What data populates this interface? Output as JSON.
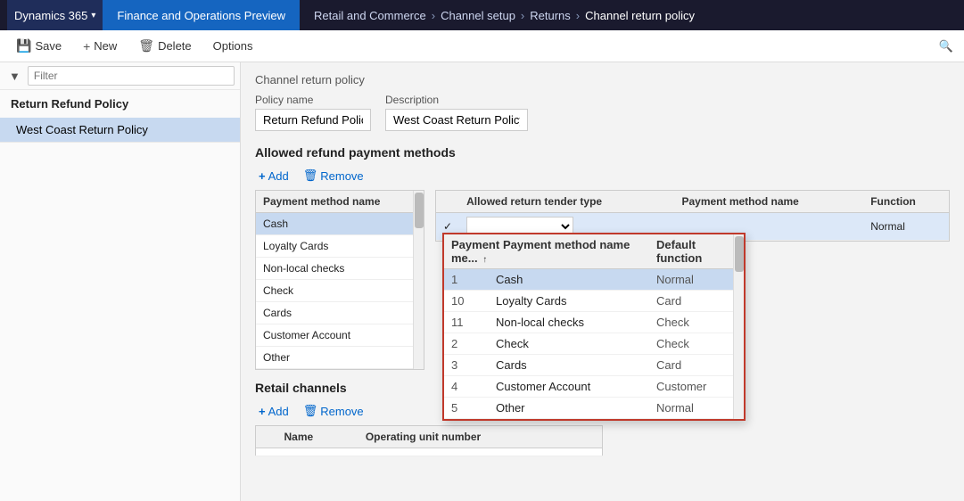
{
  "topNav": {
    "appName": "Dynamics 365",
    "appTitle": "Finance and Operations Preview",
    "breadcrumbs": [
      "Retail and Commerce",
      "Channel setup",
      "Returns",
      "Channel return policy"
    ]
  },
  "toolbar": {
    "saveLabel": "Save",
    "newLabel": "New",
    "deleteLabel": "Delete",
    "optionsLabel": "Options"
  },
  "sidebar": {
    "filterPlaceholder": "Filter",
    "groupHeader": "Return Refund Policy",
    "items": [
      {
        "label": "West Coast Return Policy",
        "selected": true
      }
    ]
  },
  "content": {
    "sectionHeader": "Channel return policy",
    "policyNameLabel": "Policy name",
    "policyNameValue": "Return Refund Policy",
    "descriptionLabel": "Description",
    "descriptionValue": "West Coast Return Policy"
  },
  "allowedRefund": {
    "title": "Allowed refund payment methods",
    "addLabel": "Add",
    "removeLabel": "Remove",
    "leftTable": {
      "header": "Payment method name",
      "rows": [
        {
          "name": "Cash",
          "selected": true
        },
        {
          "name": "Loyalty Cards",
          "selected": false
        },
        {
          "name": "Non-local checks",
          "selected": false
        },
        {
          "name": "Check",
          "selected": false
        },
        {
          "name": "Cards",
          "selected": false
        },
        {
          "name": "Customer Account",
          "selected": false
        },
        {
          "name": "Other",
          "selected": false
        }
      ]
    },
    "rightTable": {
      "columns": [
        "Allowed return tender type",
        "Payment method name",
        "Function"
      ],
      "editingRow": {
        "tenderType": "",
        "paymentMethod": "",
        "function": "Normal"
      }
    },
    "popup": {
      "columns": [
        "Payment me...",
        "Payment method name",
        "Default function"
      ],
      "rows": [
        {
          "id": "1",
          "name": "Cash",
          "function": "Normal",
          "selected": true
        },
        {
          "id": "10",
          "name": "Loyalty Cards",
          "function": "Card",
          "selected": false
        },
        {
          "id": "11",
          "name": "Non-local checks",
          "function": "Check",
          "selected": false
        },
        {
          "id": "2",
          "name": "Check",
          "function": "Check",
          "selected": false
        },
        {
          "id": "3",
          "name": "Cards",
          "function": "Card",
          "selected": false
        },
        {
          "id": "4",
          "name": "Customer Account",
          "function": "Customer",
          "selected": false
        },
        {
          "id": "5",
          "name": "Other",
          "function": "Normal",
          "selected": false
        }
      ]
    }
  },
  "retailChannels": {
    "title": "Retail channels",
    "addLabel": "Add",
    "removeLabel": "Remove",
    "columns": [
      "Name",
      "Operating unit number"
    ]
  }
}
